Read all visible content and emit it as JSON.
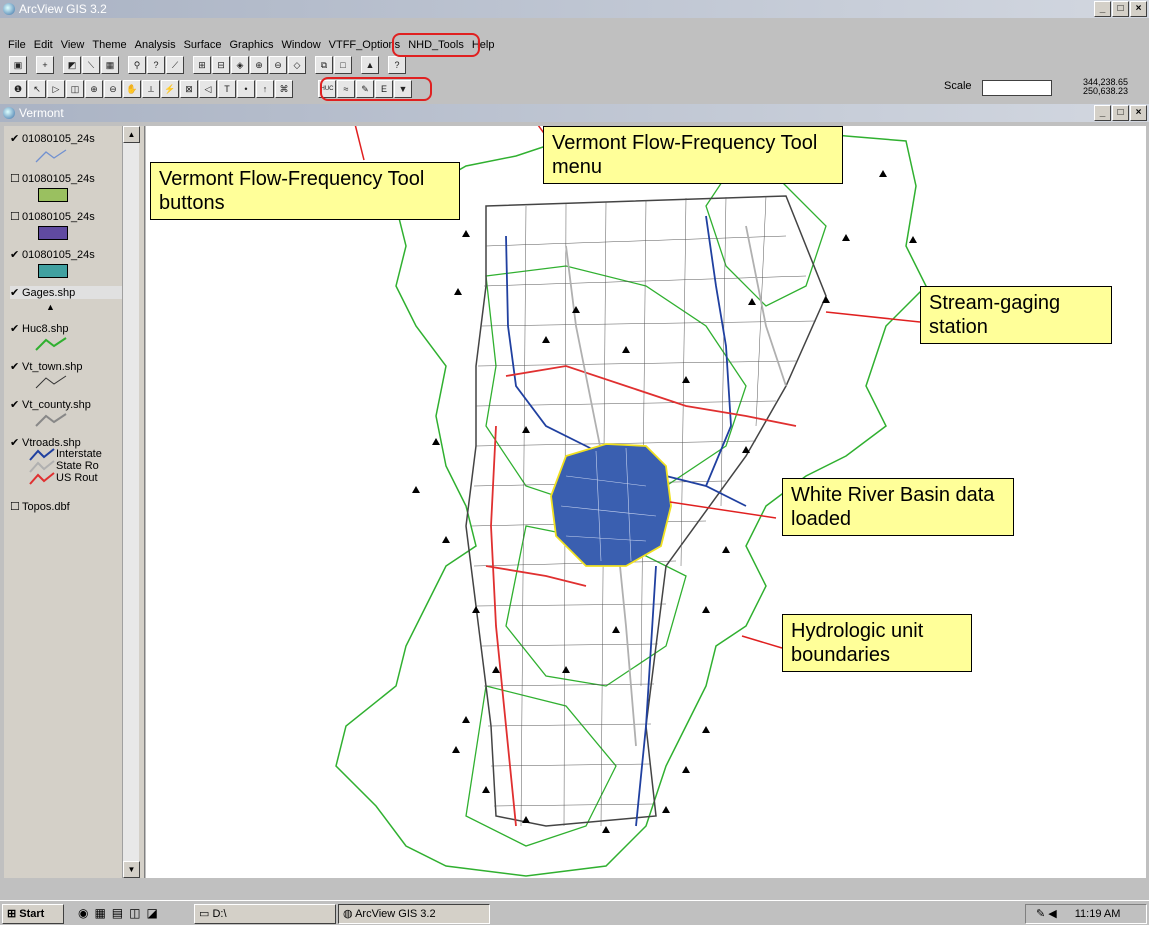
{
  "window": {
    "title": "ArcView GIS 3.2"
  },
  "menu": [
    "File",
    "Edit",
    "View",
    "Theme",
    "Analysis",
    "Surface",
    "Graphics",
    "Window",
    "VTFF_Options",
    "NHD_Tools",
    "Help"
  ],
  "statusbar": {
    "scale_label": "Scale",
    "coord_x": "344,238.65",
    "coord_y": "250,638.23"
  },
  "view": {
    "title": "Vermont"
  },
  "toc": [
    {
      "label": "01080105_24s",
      "checked": true
    },
    {
      "label": "01080105_24s",
      "checked": false
    },
    {
      "label": "01080105_24s",
      "checked": false
    },
    {
      "label": "01080105_24s",
      "checked": true
    },
    {
      "label": "Gages.shp",
      "checked": true
    },
    {
      "label": "Huc8.shp",
      "checked": true
    },
    {
      "label": "Vt_town.shp",
      "checked": true
    },
    {
      "label": "Vt_county.shp",
      "checked": true
    },
    {
      "label": "Vtroads.shp",
      "checked": true
    },
    {
      "label": "Topos.dbf",
      "checked": false
    }
  ],
  "roads_legend": [
    "Interstate",
    "State Ro",
    "US Rout"
  ],
  "callouts": {
    "buttons": "Vermont Flow-Frequency Tool buttons",
    "menu": "Vermont Flow-Frequency Tool menu",
    "gaging": "Stream-gaging station",
    "white_river": "White River Basin data loaded",
    "hydro": "Hydrologic unit boundaries"
  },
  "taskbar": {
    "start": "Start",
    "drive": "D:\\",
    "app": "ArcView GIS 3.2",
    "time": "11:19 AM"
  },
  "colors": {
    "interstate": "#2040a0",
    "state_road": "#b0b0b0",
    "us_route": "#e03030",
    "huc": "#30b030",
    "basin": "#3a5fb0",
    "basin_outline": "#f0e020"
  }
}
